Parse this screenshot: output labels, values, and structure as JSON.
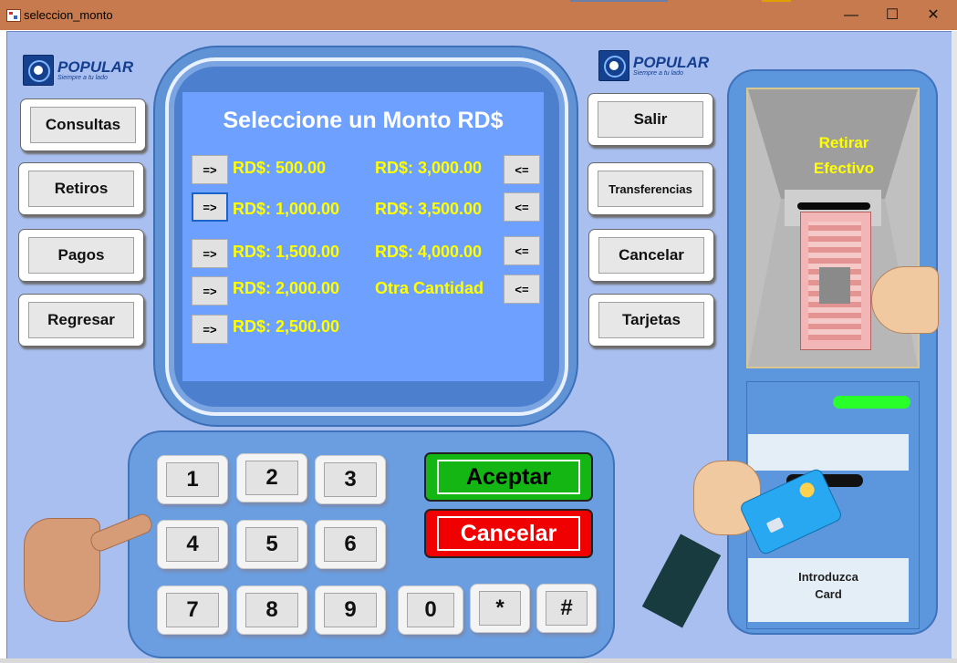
{
  "window": {
    "title": "seleccion_monto",
    "minimize": "—",
    "maximize": "☐",
    "close": "✕"
  },
  "brand": {
    "name": "POPULAR",
    "tagline": "Siempre a tu lado"
  },
  "left_menu": [
    "Consultas",
    "Retiros",
    "Pagos",
    "Regresar"
  ],
  "right_menu": [
    "Salir",
    "Transferencias",
    "Cancelar",
    "Tarjetas"
  ],
  "screen": {
    "title": "Seleccione un Monto RD$",
    "left_arrow": "=>",
    "right_arrow": "<=",
    "left_amounts": [
      "RD$: 500.00",
      "RD$: 1,000.00",
      "RD$: 1,500.00",
      "RD$: 2,000.00",
      "RD$: 2,500.00"
    ],
    "right_amounts": [
      "RD$: 3,000.00",
      "RD$: 3,500.00",
      "RD$: 4,000.00",
      "Otra Cantidad"
    ]
  },
  "keypad": {
    "keys": [
      "1",
      "2",
      "3",
      "4",
      "5",
      "6",
      "7",
      "8",
      "9",
      "0",
      "*",
      "#"
    ],
    "accept": "Aceptar",
    "cancel": "Cancelar",
    "accept_color": "#13b613",
    "cancel_color": "#f00000"
  },
  "atm": {
    "withdraw_line1": "Retirar",
    "withdraw_line2": "Efectivo",
    "card_line1": "Introduzca",
    "card_line2": "Card",
    "led_color": "#29ff29"
  }
}
